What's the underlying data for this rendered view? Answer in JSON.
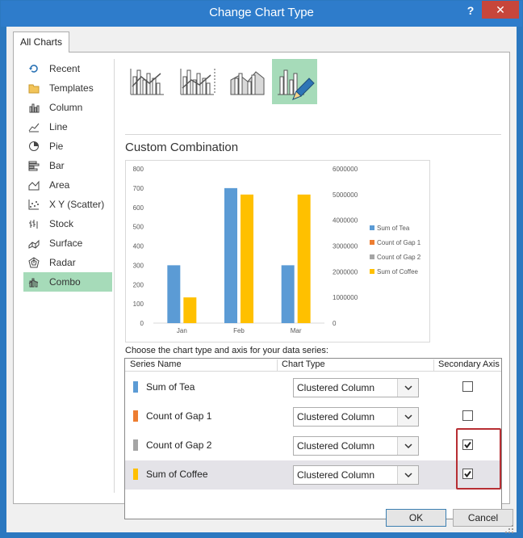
{
  "window": {
    "title": "Change Chart Type",
    "help": "?",
    "close": "✕"
  },
  "tabs": [
    {
      "label": "All Charts"
    }
  ],
  "sidebar": {
    "items": [
      {
        "label": "Recent",
        "icon": "recent-icon"
      },
      {
        "label": "Templates",
        "icon": "folder-icon"
      },
      {
        "label": "Column",
        "icon": "column-chart-icon"
      },
      {
        "label": "Line",
        "icon": "line-chart-icon"
      },
      {
        "label": "Pie",
        "icon": "pie-chart-icon"
      },
      {
        "label": "Bar",
        "icon": "bar-chart-icon"
      },
      {
        "label": "Area",
        "icon": "area-chart-icon"
      },
      {
        "label": "X Y (Scatter)",
        "icon": "scatter-chart-icon"
      },
      {
        "label": "Stock",
        "icon": "stock-chart-icon"
      },
      {
        "label": "Surface",
        "icon": "surface-chart-icon"
      },
      {
        "label": "Radar",
        "icon": "radar-chart-icon"
      },
      {
        "label": "Combo",
        "icon": "combo-chart-icon",
        "selected": true
      }
    ]
  },
  "subtypes": [
    {
      "icon": "clustered-column-line-icon"
    },
    {
      "icon": "clustered-column-line-secondary-icon"
    },
    {
      "icon": "stacked-area-clustered-column-icon"
    },
    {
      "icon": "custom-combination-icon",
      "selected": true
    }
  ],
  "main": {
    "section_title": "Custom Combination",
    "choose_label": "Choose the chart type and axis for your data series:"
  },
  "chart_data": {
    "type": "bar",
    "categories": [
      "Jan",
      "Feb",
      "Mar"
    ],
    "series": [
      {
        "name": "Sum of Tea",
        "axis": "primary",
        "color": "#5b9bd5",
        "values": [
          300,
          700,
          300
        ]
      },
      {
        "name": "Count of Gap 1",
        "axis": "secondary",
        "color": "#ed7d31",
        "values": [
          0,
          0,
          0
        ]
      },
      {
        "name": "Count of Gap 2",
        "axis": "secondary",
        "color": "#a5a5a5",
        "values": [
          0,
          0,
          0
        ]
      },
      {
        "name": "Sum of Coffee",
        "axis": "secondary",
        "color": "#ffc000",
        "values": [
          1000000,
          5000000,
          5000000
        ]
      }
    ],
    "y_primary": {
      "ticks": [
        "0",
        "100",
        "200",
        "300",
        "400",
        "500",
        "600",
        "700",
        "800"
      ],
      "range": [
        0,
        800
      ]
    },
    "y_secondary": {
      "ticks": [
        "0",
        "1000000",
        "2000000",
        "3000000",
        "4000000",
        "5000000",
        "6000000"
      ],
      "range": [
        0,
        6000000
      ]
    },
    "legend_position": "right",
    "grid": false
  },
  "series_table": {
    "headers": {
      "name": "Series Name",
      "type": "Chart Type",
      "axis": "Secondary Axis"
    },
    "rows": [
      {
        "name": "Sum of Tea",
        "color": "#5b9bd5",
        "chart_type": "Clustered Column",
        "secondary": false,
        "selected": false
      },
      {
        "name": "Count of Gap 1",
        "color": "#ed7d31",
        "chart_type": "Clustered Column",
        "secondary": false,
        "selected": false
      },
      {
        "name": "Count of Gap 2",
        "color": "#a5a5a5",
        "chart_type": "Clustered Column",
        "secondary": true,
        "selected": false
      },
      {
        "name": "Sum of Coffee",
        "color": "#ffc000",
        "chart_type": "Clustered Column",
        "secondary": true,
        "selected": true
      }
    ]
  },
  "buttons": {
    "ok": "OK",
    "cancel": "Cancel"
  }
}
